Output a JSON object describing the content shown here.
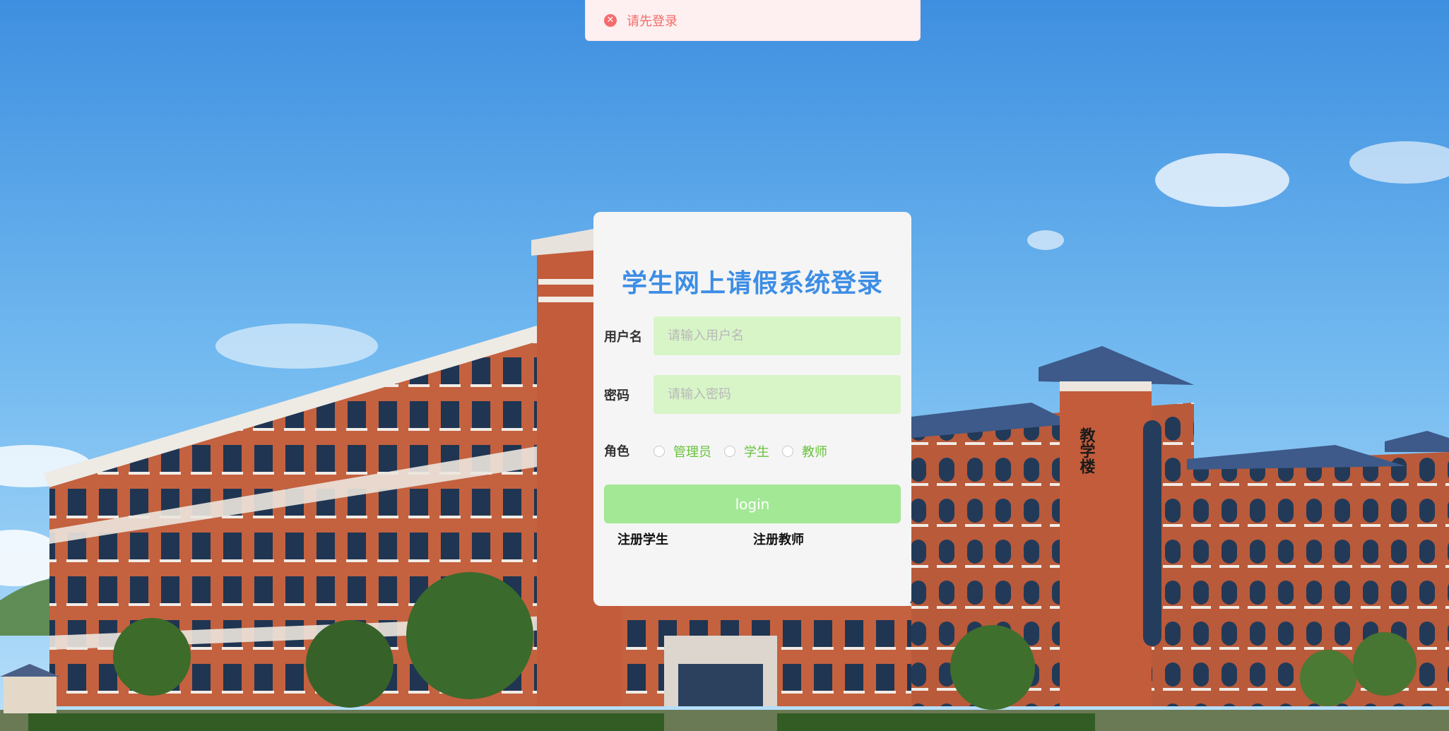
{
  "toast": {
    "icon": "error-circle-icon",
    "message": "请先登录",
    "color": "#f56c6c"
  },
  "login": {
    "title": "学生网上请假系统登录",
    "username": {
      "label": "用户名",
      "placeholder": "请输入用户名",
      "value": ""
    },
    "password": {
      "label": "密码",
      "placeholder": "请输入密码",
      "value": ""
    },
    "role": {
      "label": "角色",
      "options": [
        "管理员",
        "学生",
        "教师"
      ],
      "selected": null
    },
    "submit_label": "login",
    "register_student": "注册学生",
    "register_teacher": "注册教师"
  },
  "background": {
    "building_sign": "教学楼"
  },
  "colors": {
    "title": "#3d8ee5",
    "input_bg": "#d8f5c8",
    "button_bg": "#a3e895",
    "radio_label": "#67c23a"
  }
}
